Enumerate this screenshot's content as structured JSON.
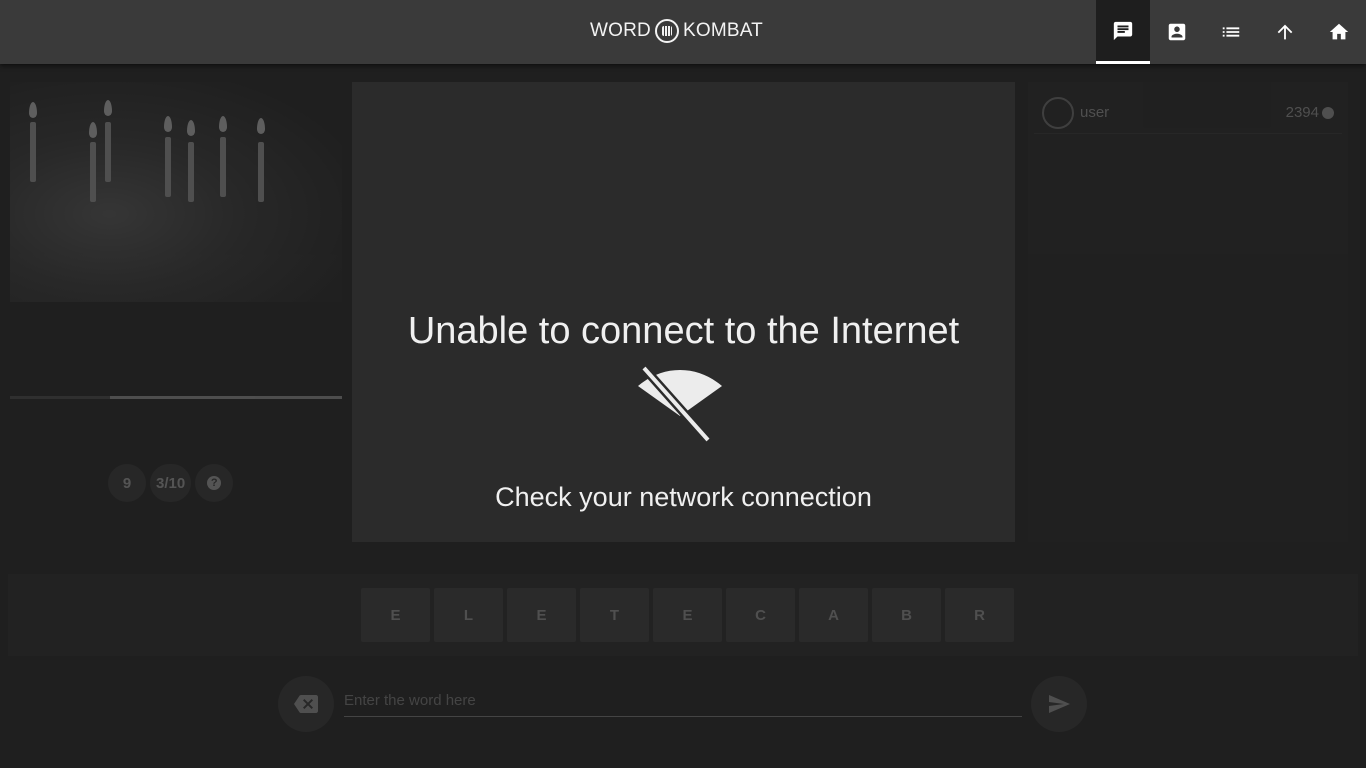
{
  "app": {
    "logo_left": "WORD",
    "logo_right": "KOMBAT"
  },
  "nav": {
    "items": [
      {
        "icon": "chat-icon",
        "active": true
      },
      {
        "icon": "contact-card-icon",
        "active": false
      },
      {
        "icon": "list-icon",
        "active": false
      },
      {
        "icon": "arrow-up-icon",
        "active": false
      },
      {
        "icon": "home-icon",
        "active": false
      }
    ]
  },
  "round": {
    "level": "9",
    "progress": "3/10",
    "help": "?",
    "timer_fraction": 0.3
  },
  "players": [
    {
      "name": "user",
      "score": "2394"
    }
  ],
  "letters": [
    "E",
    "L",
    "E",
    "T",
    "E",
    "C",
    "A",
    "B",
    "R"
  ],
  "input": {
    "placeholder": "Enter the word here"
  },
  "error_modal": {
    "title": "Unable to connect to the Internet",
    "subtitle": "Check your network connection"
  }
}
